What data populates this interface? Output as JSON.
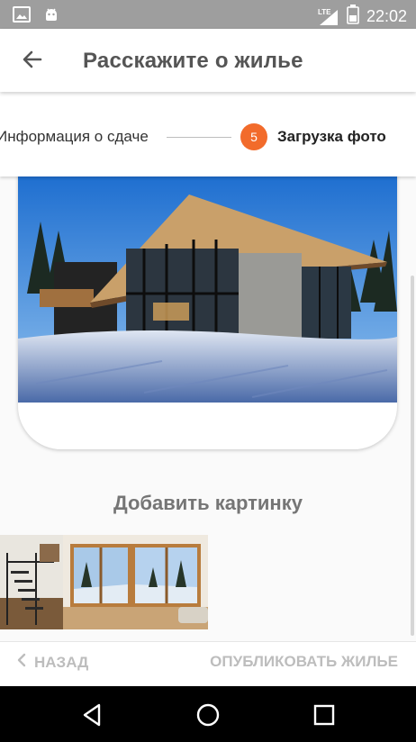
{
  "status_bar": {
    "icons": [
      "image-icon",
      "android-icon"
    ],
    "network": "LTE",
    "time": "22:02"
  },
  "app_bar": {
    "back_icon": "arrow-left-icon",
    "title": "Расскажите о жилье"
  },
  "stepper": {
    "previous_step": "Информация о сдаче",
    "current_step_number": "5",
    "current_step_label": "Загрузка фото",
    "accent_color": "#f26b2b"
  },
  "main": {
    "add_picture_label": "Добавить картинку",
    "thumbnails": [
      "staircase-interior-photo",
      "living-room-windows-photo"
    ]
  },
  "bottom_bar": {
    "back_label": "НАЗАД",
    "publish_label": "ОПУБЛИКОВАТЬ ЖИЛЬЕ"
  },
  "nav_bar": {
    "buttons": [
      "back-triangle-icon",
      "home-circle-icon",
      "recents-square-icon"
    ]
  }
}
